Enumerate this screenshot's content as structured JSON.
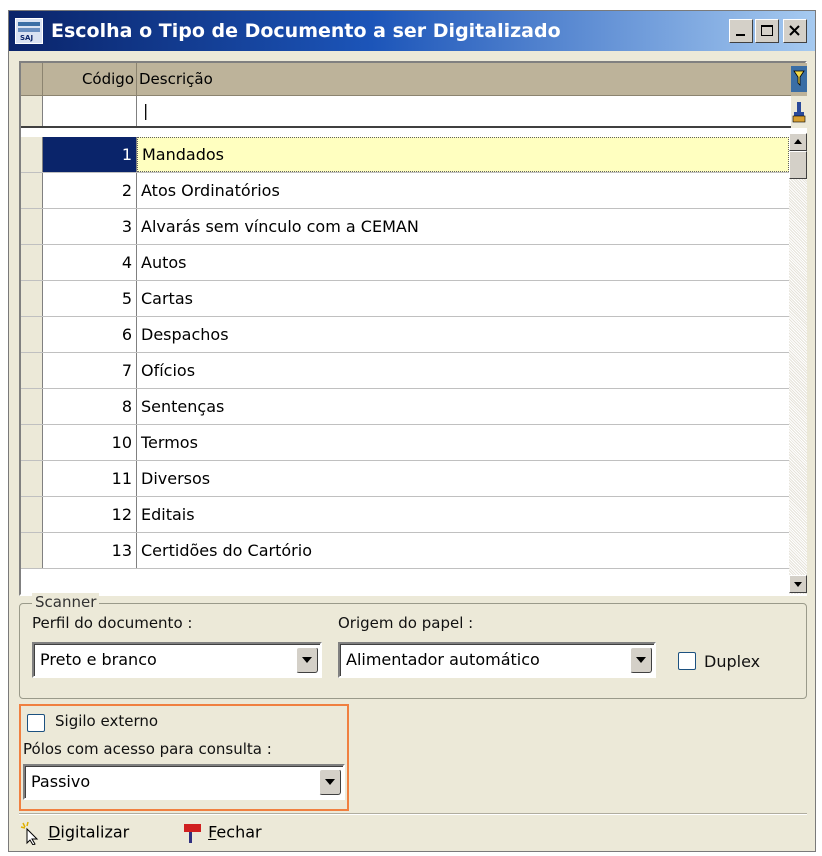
{
  "window": {
    "title": "Escolha o Tipo de Documento a ser Digitalizado",
    "icon_label": "SAJ",
    "controls": [
      "minimize-icon",
      "maximize-icon",
      "close-icon"
    ]
  },
  "grid": {
    "headers": {
      "code": "Código",
      "description": "Descrição"
    },
    "filter": {
      "code": "",
      "description": "|"
    },
    "rows": [
      {
        "code": "1",
        "description": "Mandados",
        "selected": true
      },
      {
        "code": "2",
        "description": "Atos Ordinatórios"
      },
      {
        "code": "3",
        "description": "Alvarás sem vínculo com a CEMAN"
      },
      {
        "code": "4",
        "description": "Autos"
      },
      {
        "code": "5",
        "description": "Cartas"
      },
      {
        "code": "6",
        "description": "Despachos"
      },
      {
        "code": "7",
        "description": "Ofícios"
      },
      {
        "code": "8",
        "description": "Sentenças"
      },
      {
        "code": "10",
        "description": "Termos"
      },
      {
        "code": "11",
        "description": "Diversos"
      },
      {
        "code": "12",
        "description": "Editais"
      },
      {
        "code": "13",
        "description": "Certidões do Cartório"
      }
    ]
  },
  "scanner": {
    "legend": "Scanner",
    "profile_label": "Perfil do documento :",
    "profile_value": "Preto e branco",
    "paper_label": "Origem do papel :",
    "paper_value": "Alimentador automático",
    "duplex_label": "Duplex",
    "duplex_checked": false
  },
  "access": {
    "sigilo_label": "Sigilo externo",
    "sigilo_checked": false,
    "polos_label": "Pólos com acesso para consulta :",
    "polos_value": "Passivo"
  },
  "footer": {
    "digitalizar_first": "D",
    "digitalizar_rest": "igitalizar",
    "fechar_first": "F",
    "fechar_rest": "echar"
  },
  "colors": {
    "title_start": "#0a246a",
    "title_end": "#a6caf0",
    "selected_code_bg": "#0a246a",
    "selected_desc_bg": "#ffffc0",
    "highlight_border": "#f08040"
  }
}
